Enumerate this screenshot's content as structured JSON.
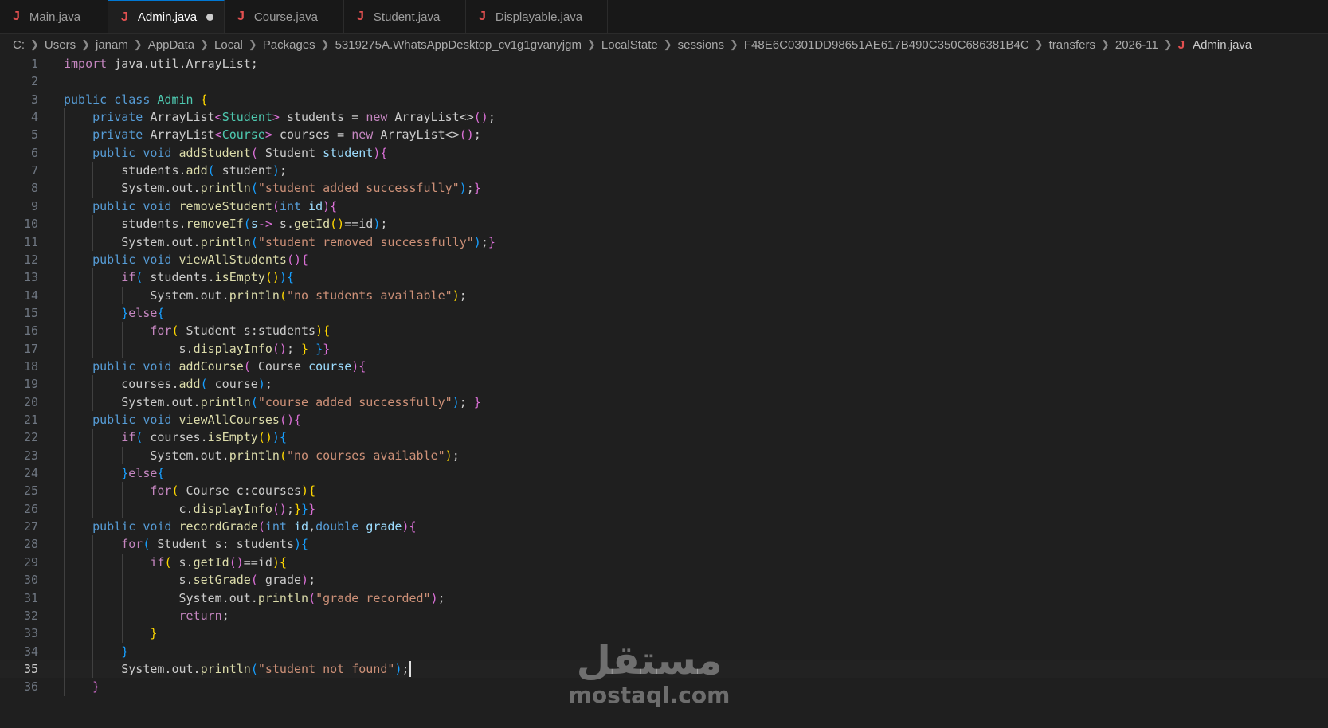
{
  "tabs": [
    {
      "label": "Main.java",
      "active": false,
      "dirty": false
    },
    {
      "label": "Admin.java",
      "active": true,
      "dirty": true
    },
    {
      "label": "Course.java",
      "active": false,
      "dirty": false
    },
    {
      "label": "Student.java",
      "active": false,
      "dirty": false
    },
    {
      "label": "Displayable.java",
      "active": false,
      "dirty": false
    }
  ],
  "breadcrumb": {
    "segments": [
      "C:",
      "Users",
      "janam",
      "AppData",
      "Local",
      "Packages",
      "5319275A.WhatsAppDesktop_cv1g1gvanyjgm",
      "LocalState",
      "sessions",
      "F48E6C0301DD98651AE617B490C350C686381B4C",
      "transfers",
      "2026-11"
    ],
    "file": "Admin.java"
  },
  "editor": {
    "current_line": 35,
    "lines": [
      {
        "n": 1,
        "indent": 0,
        "tokens": [
          [
            "ctl",
            "import"
          ],
          [
            "",
            "java.util.ArrayList;"
          ]
        ]
      },
      {
        "n": 2,
        "indent": 0,
        "tokens": []
      },
      {
        "n": 3,
        "indent": 0,
        "tokens": [
          [
            "k",
            "public"
          ],
          [
            "",
            ""
          ],
          [
            "k",
            "class"
          ],
          [
            "",
            ""
          ],
          [
            "t",
            "Admin"
          ],
          [
            "",
            ""
          ],
          [
            "b1",
            "{"
          ]
        ]
      },
      {
        "n": 4,
        "indent": 1,
        "tokens": [
          [
            "k",
            "private"
          ],
          [
            "",
            "ArrayList"
          ],
          [
            "b2",
            "<"
          ],
          [
            "t",
            "Student"
          ],
          [
            "b2",
            ">"
          ],
          [
            "",
            " students = "
          ],
          [
            "ctl",
            "new"
          ],
          [
            "",
            " ArrayList<>"
          ],
          [
            "b2",
            "()"
          ],
          [
            "",
            ";"
          ]
        ]
      },
      {
        "n": 5,
        "indent": 1,
        "tokens": [
          [
            "k",
            "private"
          ],
          [
            "",
            "ArrayList"
          ],
          [
            "b2",
            "<"
          ],
          [
            "t",
            "Course"
          ],
          [
            "b2",
            ">"
          ],
          [
            "",
            " courses = "
          ],
          [
            "ctl",
            "new"
          ],
          [
            "",
            " ArrayList<>"
          ],
          [
            "b2",
            "()"
          ],
          [
            "",
            ";"
          ]
        ]
      },
      {
        "n": 6,
        "indent": 1,
        "tokens": [
          [
            "k",
            "public"
          ],
          [
            "",
            ""
          ],
          [
            "k",
            "void"
          ],
          [
            "",
            ""
          ],
          [
            "f",
            "addStudent"
          ],
          [
            "b2",
            "("
          ],
          [
            "",
            "Student "
          ],
          [
            "p",
            "student"
          ],
          [
            "b2",
            ")"
          ],
          [
            "b2",
            "{"
          ]
        ]
      },
      {
        "n": 7,
        "indent": 2,
        "tokens": [
          [
            "",
            "students."
          ],
          [
            "f",
            "add"
          ],
          [
            "b3",
            "("
          ],
          [
            "",
            "student"
          ],
          [
            "b3",
            ")"
          ],
          [
            "",
            ";"
          ]
        ]
      },
      {
        "n": 8,
        "indent": 2,
        "tokens": [
          [
            "",
            "System.out."
          ],
          [
            "f",
            "println"
          ],
          [
            "b3",
            "("
          ],
          [
            "s",
            "\"student added successfully\""
          ],
          [
            "b3",
            ")"
          ],
          [
            "",
            ";"
          ],
          [
            "b2",
            "}"
          ]
        ]
      },
      {
        "n": 9,
        "indent": 1,
        "tokens": [
          [
            "k",
            "public"
          ],
          [
            "",
            ""
          ],
          [
            "k",
            "void"
          ],
          [
            "",
            ""
          ],
          [
            "f",
            "removeStudent"
          ],
          [
            "b2",
            "("
          ],
          [
            "k",
            "int"
          ],
          [
            "",
            ""
          ],
          [
            "p",
            "id"
          ],
          [
            "b2",
            ")"
          ],
          [
            "b2",
            "{"
          ]
        ]
      },
      {
        "n": 10,
        "indent": 2,
        "tokens": [
          [
            "",
            "students."
          ],
          [
            "f",
            "removeIf"
          ],
          [
            "b3",
            "("
          ],
          [
            "p",
            "s"
          ],
          [
            "b2",
            "->"
          ],
          [
            "",
            "s."
          ],
          [
            "f",
            "getId"
          ],
          [
            "b1",
            "()"
          ],
          [
            "",
            "==id"
          ],
          [
            "b3",
            ")"
          ],
          [
            "",
            ";"
          ]
        ]
      },
      {
        "n": 11,
        "indent": 2,
        "tokens": [
          [
            "",
            "System.out."
          ],
          [
            "f",
            "println"
          ],
          [
            "b3",
            "("
          ],
          [
            "s",
            "\"student removed successfully\""
          ],
          [
            "b3",
            ")"
          ],
          [
            "",
            ";"
          ],
          [
            "b2",
            "}"
          ]
        ]
      },
      {
        "n": 12,
        "indent": 1,
        "tokens": [
          [
            "k",
            "public"
          ],
          [
            "",
            ""
          ],
          [
            "k",
            "void"
          ],
          [
            "",
            ""
          ],
          [
            "f",
            "viewAllStudents"
          ],
          [
            "b2",
            "()"
          ],
          [
            "b2",
            "{"
          ]
        ]
      },
      {
        "n": 13,
        "indent": 2,
        "tokens": [
          [
            "ctl",
            "if"
          ],
          [
            "b3",
            "("
          ],
          [
            "",
            "students."
          ],
          [
            "f",
            "isEmpty"
          ],
          [
            "b1",
            "()"
          ],
          [
            "b3",
            ")"
          ],
          [
            "b3",
            "{"
          ]
        ]
      },
      {
        "n": 14,
        "indent": 3,
        "tokens": [
          [
            "",
            "System.out."
          ],
          [
            "f",
            "println"
          ],
          [
            "b1",
            "("
          ],
          [
            "s",
            "\"no students available\""
          ],
          [
            "b1",
            ")"
          ],
          [
            "",
            ";"
          ]
        ]
      },
      {
        "n": 15,
        "indent": 2,
        "tokens": [
          [
            "b3",
            "}"
          ],
          [
            "ctl",
            "else"
          ],
          [
            "b3",
            "{"
          ]
        ]
      },
      {
        "n": 16,
        "indent": 3,
        "tokens": [
          [
            "ctl",
            "for"
          ],
          [
            "b1",
            "("
          ],
          [
            "",
            "Student s:students"
          ],
          [
            "b1",
            ")"
          ],
          [
            "b1",
            "{"
          ]
        ]
      },
      {
        "n": 17,
        "indent": 4,
        "tokens": [
          [
            "",
            "s."
          ],
          [
            "f",
            "displayInfo"
          ],
          [
            "b2",
            "()"
          ],
          [
            "",
            "; "
          ],
          [
            "b1",
            "}"
          ],
          [
            "",
            ""
          ],
          [
            "b3",
            "}"
          ],
          [
            "b2",
            "}"
          ]
        ]
      },
      {
        "n": 18,
        "indent": 1,
        "tokens": [
          [
            "k",
            "public"
          ],
          [
            "",
            ""
          ],
          [
            "k",
            "void"
          ],
          [
            "",
            ""
          ],
          [
            "f",
            "addCourse"
          ],
          [
            "b2",
            "("
          ],
          [
            "",
            "Course "
          ],
          [
            "p",
            "course"
          ],
          [
            "b2",
            ")"
          ],
          [
            "b2",
            "{"
          ]
        ]
      },
      {
        "n": 19,
        "indent": 2,
        "tokens": [
          [
            "",
            "courses."
          ],
          [
            "f",
            "add"
          ],
          [
            "b3",
            "("
          ],
          [
            "",
            "course"
          ],
          [
            "b3",
            ")"
          ],
          [
            "",
            ";"
          ]
        ]
      },
      {
        "n": 20,
        "indent": 2,
        "tokens": [
          [
            "",
            "System.out."
          ],
          [
            "f",
            "println"
          ],
          [
            "b3",
            "("
          ],
          [
            "s",
            "\"course added successfully\""
          ],
          [
            "b3",
            ")"
          ],
          [
            "",
            "; "
          ],
          [
            "b2",
            "}"
          ]
        ]
      },
      {
        "n": 21,
        "indent": 1,
        "tokens": [
          [
            "k",
            "public"
          ],
          [
            "",
            ""
          ],
          [
            "k",
            "void"
          ],
          [
            "",
            ""
          ],
          [
            "f",
            "viewAllCourses"
          ],
          [
            "b2",
            "()"
          ],
          [
            "b2",
            "{"
          ]
        ]
      },
      {
        "n": 22,
        "indent": 2,
        "tokens": [
          [
            "ctl",
            "if"
          ],
          [
            "b3",
            "("
          ],
          [
            "",
            "courses."
          ],
          [
            "f",
            "isEmpty"
          ],
          [
            "b1",
            "()"
          ],
          [
            "b3",
            ")"
          ],
          [
            "b3",
            "{"
          ]
        ]
      },
      {
        "n": 23,
        "indent": 3,
        "tokens": [
          [
            "",
            "System.out."
          ],
          [
            "f",
            "println"
          ],
          [
            "b1",
            "("
          ],
          [
            "s",
            "\"no courses available\""
          ],
          [
            "b1",
            ")"
          ],
          [
            "",
            ";"
          ]
        ]
      },
      {
        "n": 24,
        "indent": 2,
        "tokens": [
          [
            "b3",
            "}"
          ],
          [
            "ctl",
            "else"
          ],
          [
            "b3",
            "{"
          ]
        ]
      },
      {
        "n": 25,
        "indent": 3,
        "tokens": [
          [
            "ctl",
            "for"
          ],
          [
            "b1",
            "("
          ],
          [
            "",
            "Course c:courses"
          ],
          [
            "b1",
            ")"
          ],
          [
            "b1",
            "{"
          ]
        ]
      },
      {
        "n": 26,
        "indent": 4,
        "tokens": [
          [
            "",
            "c."
          ],
          [
            "f",
            "displayInfo"
          ],
          [
            "b2",
            "()"
          ],
          [
            "",
            ";"
          ],
          [
            "b1",
            "}"
          ],
          [
            "b3",
            "}"
          ],
          [
            "b2",
            "}"
          ]
        ]
      },
      {
        "n": 27,
        "indent": 1,
        "tokens": [
          [
            "k",
            "public"
          ],
          [
            "",
            ""
          ],
          [
            "k",
            "void"
          ],
          [
            "",
            ""
          ],
          [
            "f",
            "recordGrade"
          ],
          [
            "b2",
            "("
          ],
          [
            "k",
            "int"
          ],
          [
            "",
            ""
          ],
          [
            "p",
            "id"
          ],
          [
            "",
            ","
          ],
          [
            "k",
            "double"
          ],
          [
            "",
            ""
          ],
          [
            "p",
            "grade"
          ],
          [
            "b2",
            ")"
          ],
          [
            "b2",
            "{"
          ]
        ]
      },
      {
        "n": 28,
        "indent": 2,
        "tokens": [
          [
            "ctl",
            "for"
          ],
          [
            "b3",
            "("
          ],
          [
            "",
            "Student s: students"
          ],
          [
            "b3",
            ")"
          ],
          [
            "b3",
            "{"
          ]
        ]
      },
      {
        "n": 29,
        "indent": 3,
        "tokens": [
          [
            "ctl",
            "if"
          ],
          [
            "b1",
            "("
          ],
          [
            "",
            "s."
          ],
          [
            "f",
            "getId"
          ],
          [
            "b2",
            "()"
          ],
          [
            "",
            "==id"
          ],
          [
            "b1",
            ")"
          ],
          [
            "b1",
            "{"
          ]
        ]
      },
      {
        "n": 30,
        "indent": 4,
        "tokens": [
          [
            "",
            "s."
          ],
          [
            "f",
            "setGrade"
          ],
          [
            "b2",
            "("
          ],
          [
            "",
            "grade"
          ],
          [
            "b2",
            ")"
          ],
          [
            "",
            ";"
          ]
        ]
      },
      {
        "n": 31,
        "indent": 4,
        "tokens": [
          [
            "",
            "System.out."
          ],
          [
            "f",
            "println"
          ],
          [
            "b2",
            "("
          ],
          [
            "s",
            "\"grade recorded\""
          ],
          [
            "b2",
            ")"
          ],
          [
            "",
            ";"
          ]
        ]
      },
      {
        "n": 32,
        "indent": 4,
        "tokens": [
          [
            "ctl",
            "return"
          ],
          [
            "",
            ";"
          ]
        ]
      },
      {
        "n": 33,
        "indent": 3,
        "tokens": [
          [
            "b1",
            "}"
          ]
        ]
      },
      {
        "n": 34,
        "indent": 2,
        "tokens": [
          [
            "b3",
            "}"
          ]
        ]
      },
      {
        "n": 35,
        "indent": 2,
        "tokens": [
          [
            "",
            "System.out."
          ],
          [
            "f",
            "println"
          ],
          [
            "b3",
            "("
          ],
          [
            "s",
            "\"student not found\""
          ],
          [
            "b3",
            ")"
          ],
          [
            "",
            ";"
          ]
        ]
      },
      {
        "n": 36,
        "indent": 1,
        "tokens": [
          [
            "b2",
            "}"
          ]
        ]
      }
    ]
  },
  "watermark": {
    "arabic": "مستقل",
    "latin": "mostaql.com"
  }
}
